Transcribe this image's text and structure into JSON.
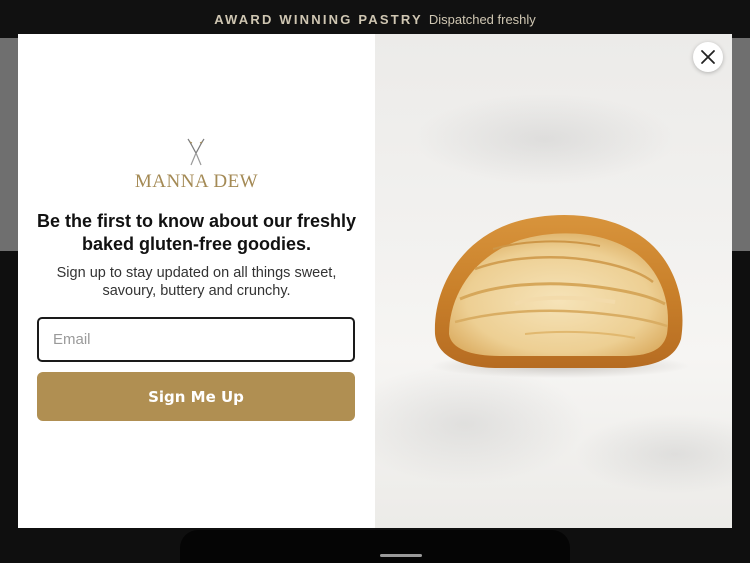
{
  "announcement": {
    "highlight": "AWARD WINNING PASTRY",
    "text": "Dispatched freshly"
  },
  "modal": {
    "brand": "MANNA DEW",
    "logo_icon": "crossed-wheat-icon",
    "headline": "Be the first to know about our freshly baked gluten-free goodies.",
    "subtext": "Sign up to stay updated on all things sweet, savoury, buttery and crunchy.",
    "email_placeholder": "Email",
    "email_value": "",
    "submit_label": "Sign Me Up",
    "close_icon": "close-icon",
    "image": "croissant-cross-section-photo"
  },
  "colors": {
    "accent": "#b08f52",
    "brand_text": "#a48a55",
    "announce_bg": "#111111",
    "overlay": "#6f6f6f"
  }
}
